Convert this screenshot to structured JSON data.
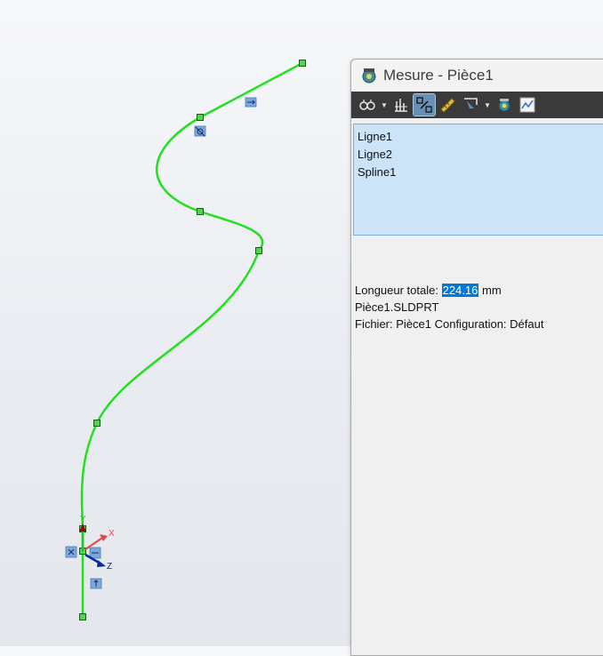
{
  "window": {
    "title": "Mesure - Pièce1"
  },
  "toolbar": {
    "buttons": [
      {
        "name": "arc-circle-measure-icon",
        "has_dropdown": true
      },
      {
        "name": "units-precision-icon",
        "has_dropdown": false
      },
      {
        "name": "show-xyz-measurements-icon",
        "has_dropdown": false,
        "active": true
      },
      {
        "name": "point-to-point-icon",
        "has_dropdown": false
      },
      {
        "name": "projection-icon",
        "has_dropdown": true
      },
      {
        "name": "measurement-history-icon",
        "has_dropdown": false
      },
      {
        "name": "create-sensor-icon",
        "has_dropdown": false
      }
    ]
  },
  "selection": {
    "items": [
      "Ligne1",
      "Ligne2",
      "Spline1"
    ]
  },
  "results": {
    "total_length_label": "Longueur totale:",
    "total_length_value": "224.16",
    "total_length_unit": "mm",
    "part_file": "Pièce1.SLDPRT",
    "file_config": "Fichier: Pièce1 Configuration: Défaut"
  },
  "triad": {
    "x_label": "X",
    "y_label": "Y",
    "z_label": "Z"
  },
  "colors": {
    "sketch_line": "#22e01f",
    "selection_bg": "#cce4f7",
    "toolbar_bg": "#3a3a3a",
    "highlight": "#0078d7"
  }
}
